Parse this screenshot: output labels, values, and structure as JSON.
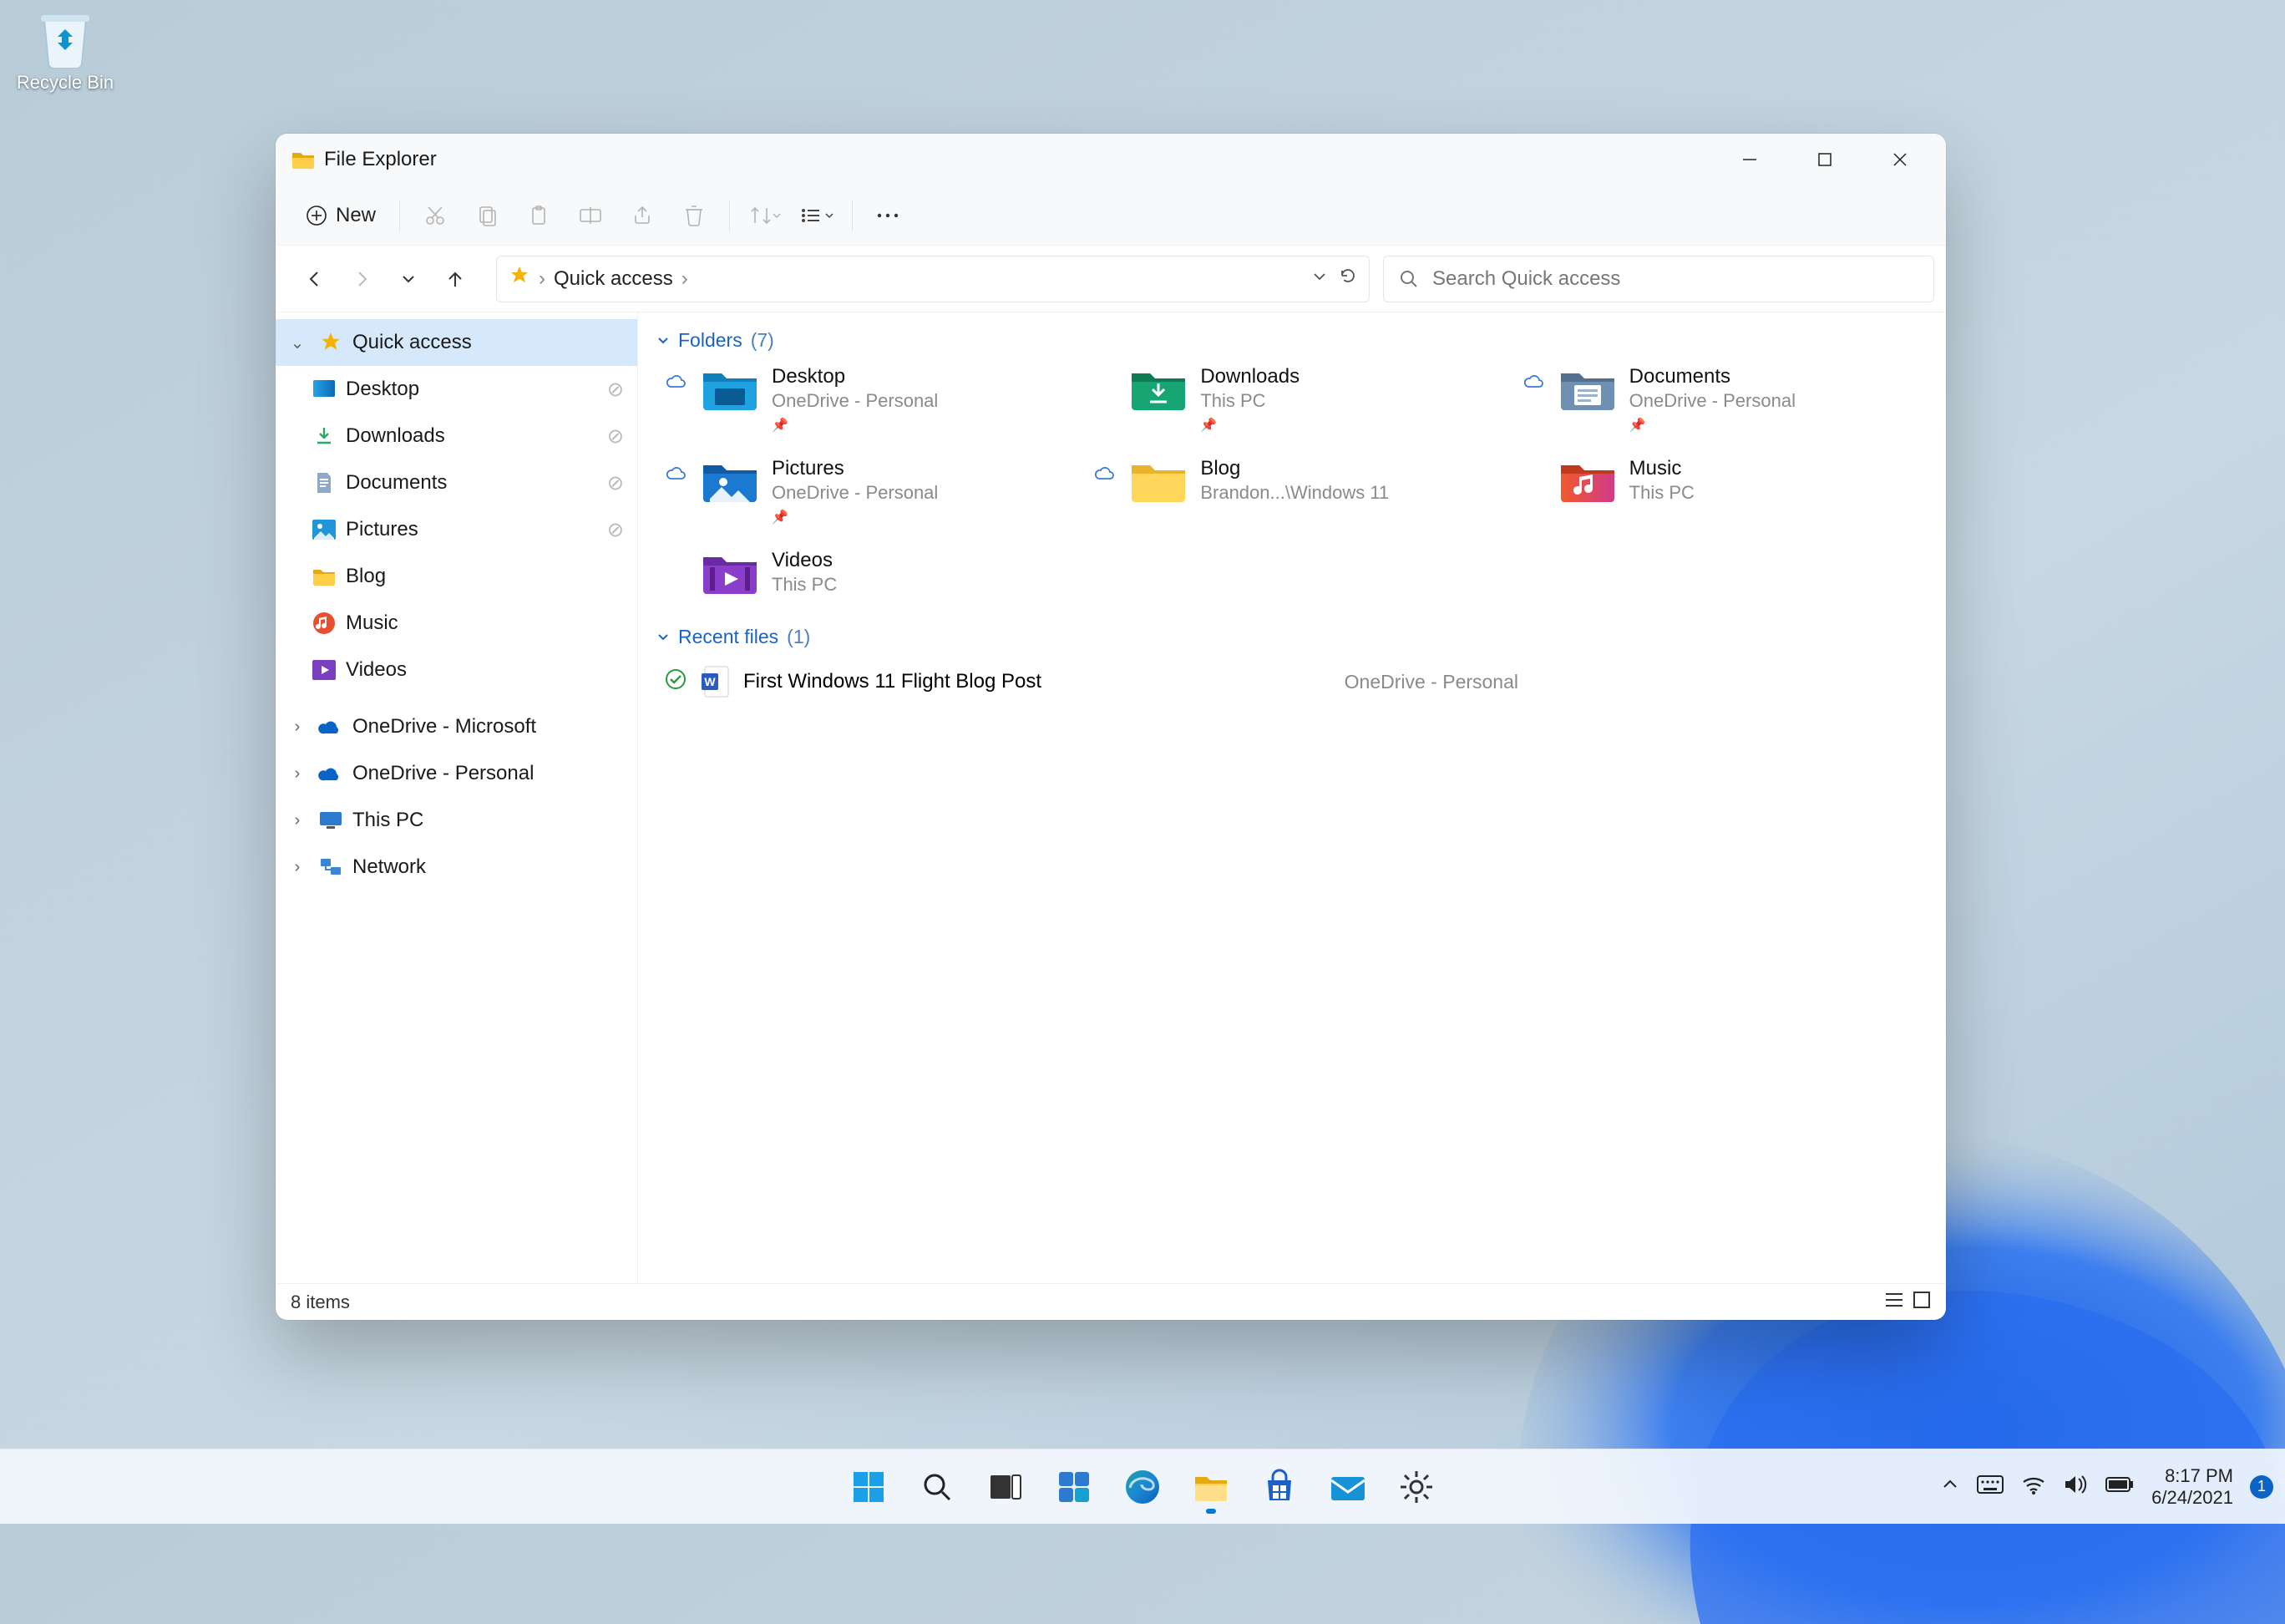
{
  "desktop": {
    "recycle_bin": "Recycle Bin"
  },
  "window": {
    "title": "File Explorer",
    "toolbar": {
      "new": "New"
    },
    "address": {
      "root": "Quick access"
    },
    "search": {
      "placeholder": "Search Quick access"
    },
    "status": {
      "items": "8 items"
    }
  },
  "sidebar": {
    "quick_access": "Quick access",
    "desktop": "Desktop",
    "downloads": "Downloads",
    "documents": "Documents",
    "pictures": "Pictures",
    "blog": "Blog",
    "music": "Music",
    "videos": "Videos",
    "onedrive_ms": "OneDrive - Microsoft",
    "onedrive_personal": "OneDrive - Personal",
    "this_pc": "This PC",
    "network": "Network"
  },
  "groups": {
    "folders_label": "Folders",
    "folders_count": "(7)",
    "recent_label": "Recent files",
    "recent_count": "(1)"
  },
  "folders": {
    "desktop": {
      "name": "Desktop",
      "sub": "OneDrive - Personal"
    },
    "downloads": {
      "name": "Downloads",
      "sub": "This PC"
    },
    "documents": {
      "name": "Documents",
      "sub": "OneDrive - Personal"
    },
    "pictures": {
      "name": "Pictures",
      "sub": "OneDrive - Personal"
    },
    "blog": {
      "name": "Blog",
      "sub": "Brandon...\\Windows 11"
    },
    "music": {
      "name": "Music",
      "sub": "This PC"
    },
    "videos": {
      "name": "Videos",
      "sub": "This PC"
    }
  },
  "recent": {
    "file1": {
      "name": "First Windows 11 Flight Blog Post",
      "loc": "OneDrive - Personal"
    }
  },
  "tray": {
    "time": "8:17 PM",
    "date": "6/24/2021",
    "notif": "1"
  }
}
